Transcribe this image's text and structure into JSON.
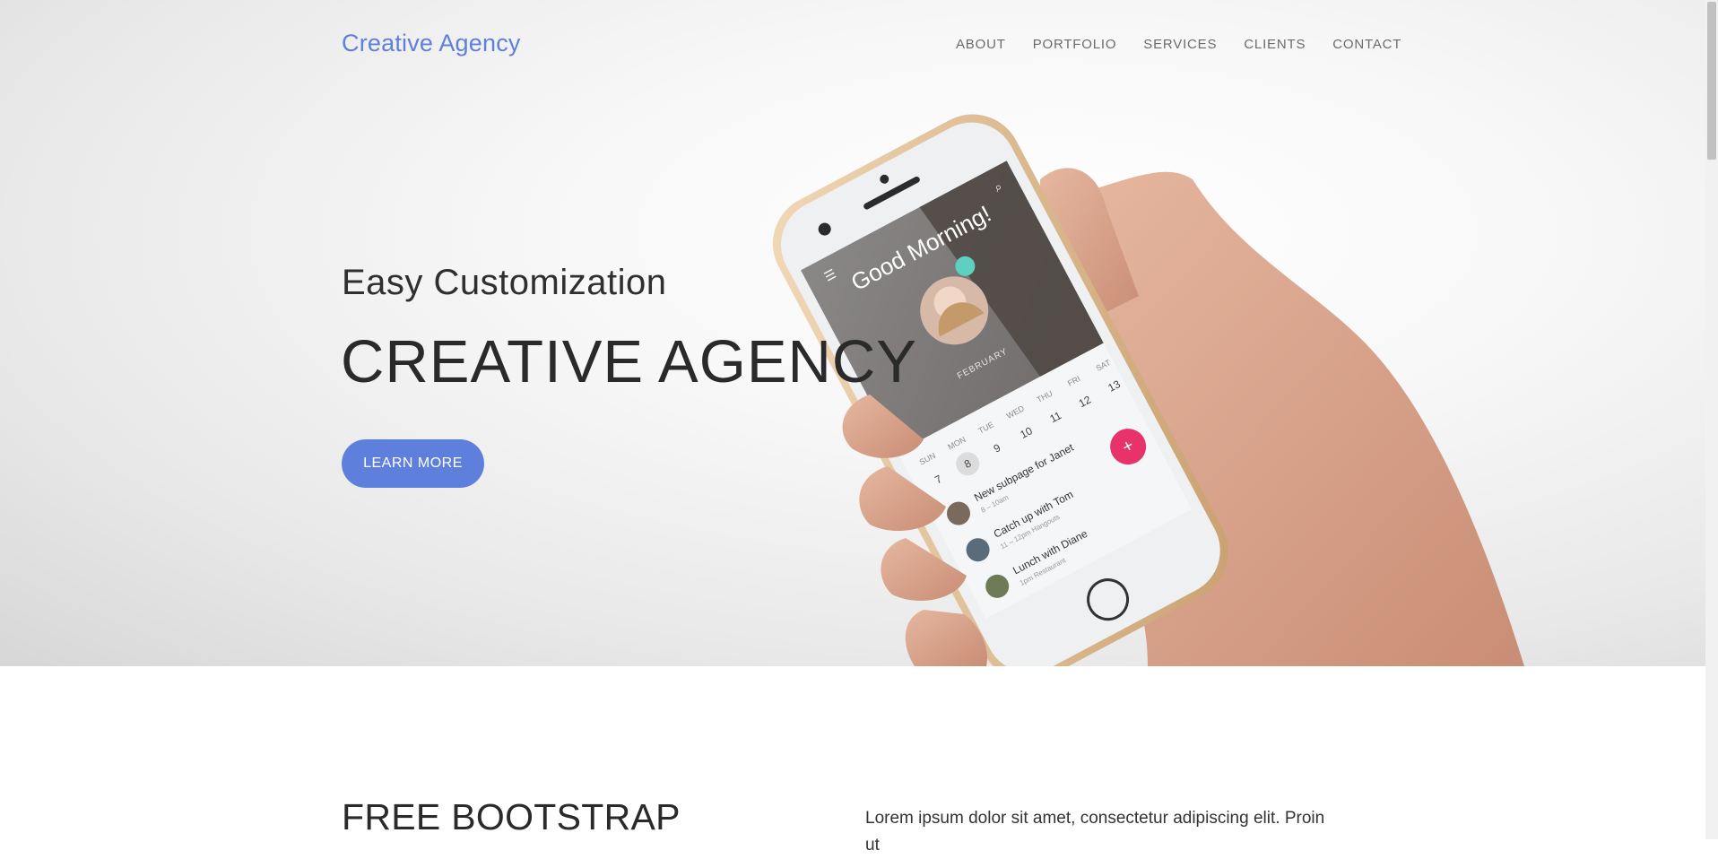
{
  "navbar": {
    "brand": "Creative Agency",
    "links": [
      "ABOUT",
      "PORTFOLIO",
      "SERVICES",
      "CLIENTS",
      "CONTACT"
    ]
  },
  "hero": {
    "subtitle": "Easy Customization",
    "title": "CREATIVE AGENCY",
    "cta_label": "LEARN MORE"
  },
  "phone_screen": {
    "greeting": "Good Morning!",
    "month": "FEBRUARY",
    "weekdays": [
      "SUN",
      "MON",
      "TUE",
      "WED",
      "THU",
      "FRI",
      "SAT"
    ],
    "days": [
      "7",
      "8",
      "9",
      "10",
      "11",
      "12",
      "13"
    ],
    "events": [
      {
        "title": "New subpage for Janet",
        "time": "8 – 10am"
      },
      {
        "title": "Catch up with Tom",
        "time": "11 – 12pm   Hangouts"
      },
      {
        "title": "Lunch with Diane",
        "time": "1pm   Restaurant"
      }
    ]
  },
  "section": {
    "heading": "FREE BOOTSTRAP",
    "text": "Lorem ipsum dolor sit amet, consectetur adipiscing elit. Proin ut"
  },
  "colors": {
    "accent": "#5f7fdc",
    "fab": "#e8326a",
    "text_dark": "#2a2a2a"
  }
}
